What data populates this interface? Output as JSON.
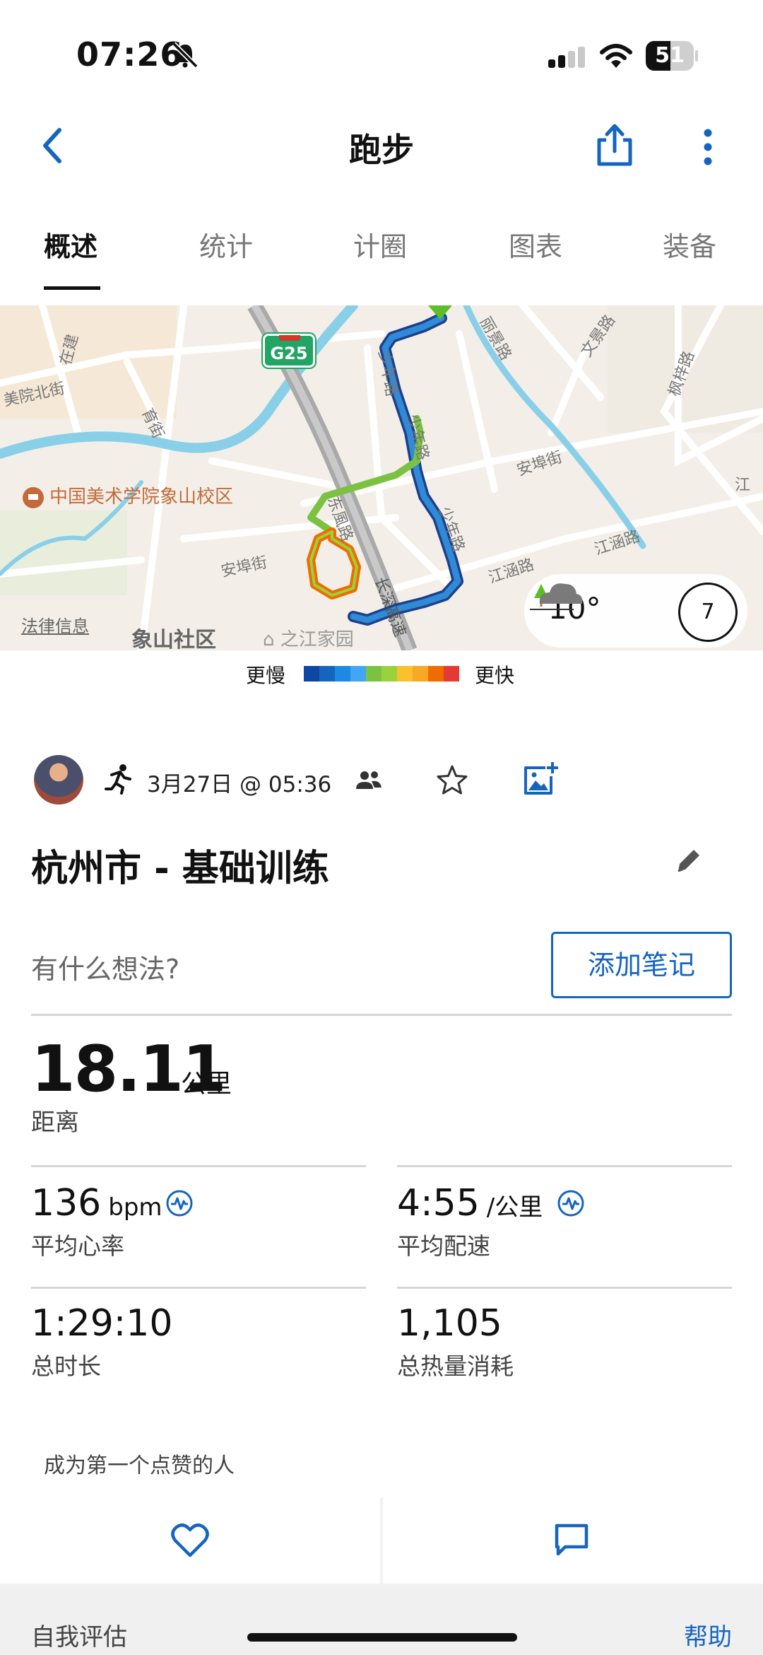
{
  "status_bar": {
    "time": "07:26",
    "battery_level": "51",
    "battery_fraction": 0.51
  },
  "header": {
    "title": "跑步"
  },
  "tabs": [
    {
      "label": "概述",
      "active": true
    },
    {
      "label": "统计",
      "active": false
    },
    {
      "label": "计圈",
      "active": false
    },
    {
      "label": "图表",
      "active": false
    },
    {
      "label": "装备",
      "active": false
    }
  ],
  "map": {
    "labels": {
      "zaijie": "在建",
      "meiyuan": "美院北街",
      "yujie": "育街",
      "shaonian1": "少年路",
      "shaonian2": "少年路",
      "shaonian3": "少年路",
      "dongfeng": "东風路",
      "anfu1": "安埠街",
      "anfu2": "安埠街",
      "jiangzong1": "江涵路",
      "jiangzong2": "江涵路",
      "lijing": "丽景路",
      "wenjing": "文景路",
      "fengzi": "枫梓路",
      "changshen": "长深高速",
      "jiang": "江"
    },
    "highway_badge": "G25",
    "poi": "中国美术学院象山校区",
    "legal": "法律信息",
    "community": "象山社区",
    "home_label": "之江家园",
    "temperature": "10°",
    "wind": "7"
  },
  "speed_legend": {
    "slow": "更慢",
    "fast": "更快",
    "colors": [
      "#0d47a1",
      "#1565c0",
      "#1e88e5",
      "#42a5f5",
      "#7cc242",
      "#9bd23c",
      "#fbc02d",
      "#f9a825",
      "#ef6c00",
      "#e53935"
    ]
  },
  "activity": {
    "date": "3月27日 @ 05:36",
    "name": "杭州市 - 基础训练",
    "note_prompt": "有什么想法?",
    "add_note": "添加笔记"
  },
  "stats": {
    "distance": {
      "value": "18.11",
      "unit": "公里",
      "label": "距离"
    },
    "heart_rate": {
      "value": "136",
      "unit": "bpm",
      "label": "平均心率"
    },
    "pace": {
      "value": "4:55",
      "unit": "/公里",
      "label": "平均配速"
    },
    "duration": {
      "value": "1:29:10",
      "label": "总时长"
    },
    "calories": {
      "value": "1,105",
      "label": "总热量消耗"
    }
  },
  "social": {
    "like_prompt": "成为第一个点赞的人"
  },
  "footer": {
    "left": "自我评估",
    "right": "帮助"
  },
  "colors": {
    "accent": "#1565c0",
    "route_start": "#5cbf2a"
  }
}
